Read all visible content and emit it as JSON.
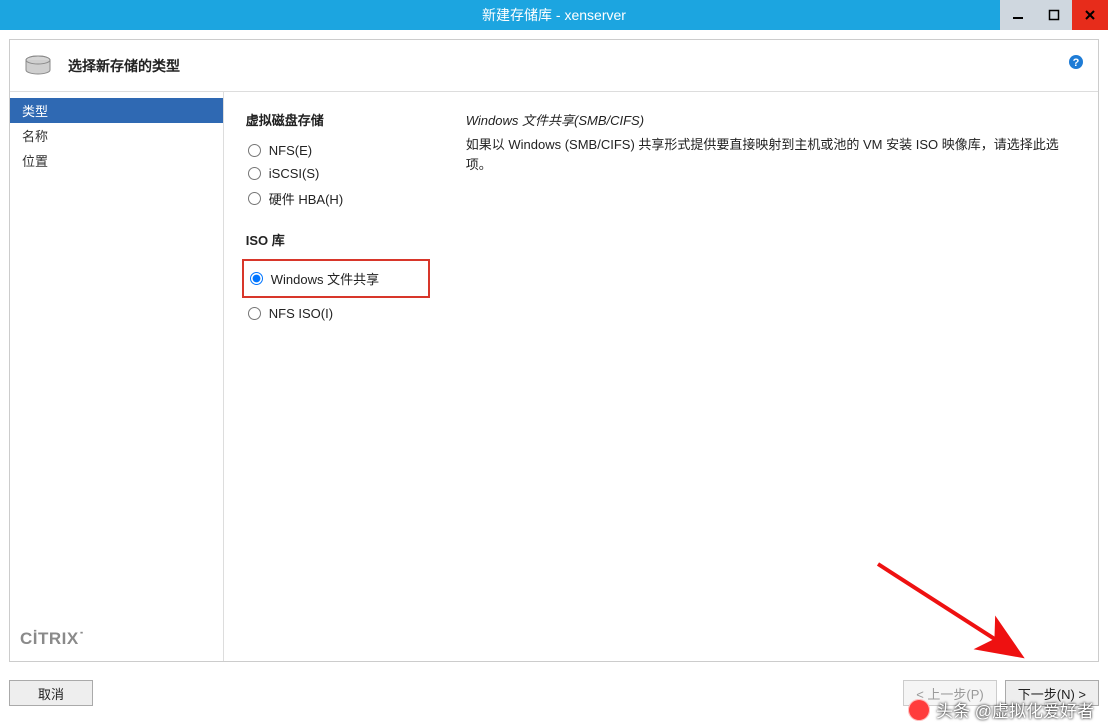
{
  "window": {
    "title": "新建存储库 - xenserver"
  },
  "header": {
    "step_title": "选择新存储的类型"
  },
  "nav": {
    "items": [
      {
        "label": "类型",
        "selected": true
      },
      {
        "label": "名称",
        "selected": false
      },
      {
        "label": "位置",
        "selected": false
      }
    ]
  },
  "brand": {
    "text": "CİTRIX"
  },
  "options": {
    "virtual_disk_heading": "虚拟磁盘存储",
    "virtual_disk": [
      {
        "id": "nfs",
        "label": "NFS(E)",
        "selected": false
      },
      {
        "id": "iscsi",
        "label": "iSCSI(S)",
        "selected": false
      },
      {
        "id": "hba",
        "label": "硬件 HBA(H)",
        "selected": false
      }
    ],
    "iso_heading": "ISO 库",
    "iso": [
      {
        "id": "win_share",
        "label": "Windows 文件共享",
        "selected": true,
        "highlighted": true
      },
      {
        "id": "nfs_iso",
        "label": "NFS ISO(I)",
        "selected": false,
        "highlighted": false
      }
    ]
  },
  "description": {
    "title": "Windows 文件共享(SMB/CIFS)",
    "body": "如果以 Windows (SMB/CIFS) 共享形式提供要直接映射到主机或池的 VM 安装 ISO 映像库，请选择此选项。"
  },
  "buttons": {
    "cancel": "取消",
    "back": "< 上一步(P)",
    "next": "下一步(N) >"
  },
  "watermark": {
    "text": "头条 @虚拟化爱好者"
  }
}
